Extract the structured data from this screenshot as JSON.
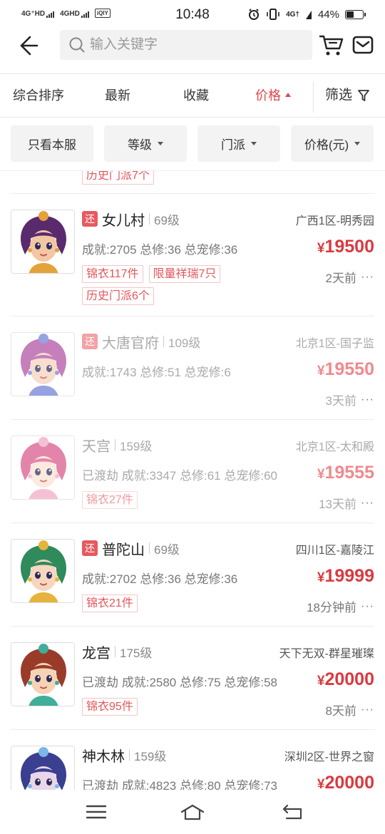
{
  "status_bar": {
    "net1": "4G⁺HD",
    "net2": "4GHD",
    "time": "10:48",
    "net3": "4G†",
    "battery": "44%"
  },
  "header": {
    "search_placeholder": "输入关键字"
  },
  "sort_tabs": [
    {
      "label": "综合排序",
      "active": false
    },
    {
      "label": "最新",
      "active": false
    },
    {
      "label": "收藏",
      "active": false
    },
    {
      "label": "价格",
      "active": true
    }
  ],
  "filter_label": "筛选",
  "chips": [
    {
      "label": "只看本服",
      "dropdown": false
    },
    {
      "label": "等级",
      "dropdown": true
    },
    {
      "label": "门派",
      "dropdown": true
    },
    {
      "label": "价格(元)",
      "dropdown": true
    }
  ],
  "partial_tag": "历史门派7个",
  "items": [
    {
      "badge": "还",
      "school": "女儿村",
      "level": "69级",
      "server": "广西1区-明秀园",
      "stats": "成就:2705 总修:36 总宠修:36",
      "price": "19500",
      "tags": [
        "锦衣117件",
        "限量祥瑞7只",
        "历史门派6个"
      ],
      "time": "2天前",
      "faded": false,
      "avatar": {
        "skin": "#f3c7a4",
        "hair": "#5a2a6e",
        "accent": "#e4a23a"
      }
    },
    {
      "badge": "还",
      "school": "大唐官府",
      "level": "109级",
      "server": "北京1区-国子监",
      "stats": "成就:1743 总修:51 总宠修:6",
      "price": "19550",
      "tags": [],
      "time": "3天前",
      "faded": true,
      "avatar": {
        "skin": "#f5d2bd",
        "hair": "#b04fa0",
        "accent": "#6f7fd6"
      }
    },
    {
      "badge": "",
      "school": "天宫",
      "level": "159级",
      "server": "北京1区-太和殿",
      "stats": "已渡劫 成就:3347 总修:61 总宠修:60",
      "price": "19555",
      "tags": [
        "锦衣27件"
      ],
      "time": "13天前",
      "faded": true,
      "avatar": {
        "skin": "#fbe1d4",
        "hair": "#d9578a",
        "accent": "#f2a9c4"
      }
    },
    {
      "badge": "还",
      "school": "普陀山",
      "level": "69级",
      "server": "四川1区-嘉陵江",
      "stats": "成就:2702 总修:36 总宠修:36",
      "price": "19999",
      "tags": [
        "锦衣21件"
      ],
      "time": "18分钟前",
      "faded": false,
      "avatar": {
        "skin": "#f7d6c0",
        "hair": "#2f8a5c",
        "accent": "#e6b43c"
      }
    },
    {
      "badge": "",
      "school": "龙宫",
      "level": "175级",
      "server": "天下无双-群星璀璨",
      "stats": "已渡劫 成就:2580 总修:75 总宠修:58",
      "price": "20000",
      "tags": [
        "锦衣95件"
      ],
      "time": "8天前",
      "faded": false,
      "avatar": {
        "skin": "#f6d3b6",
        "hair": "#9a3b2a",
        "accent": "#3fae9a"
      }
    },
    {
      "badge": "",
      "school": "神木林",
      "level": "159级",
      "server": "深圳2区-世界之窗",
      "stats": "已渡劫 成就:4823 总修:80 总宠修:73",
      "price": "20000",
      "tags": [],
      "time": "",
      "faded": false,
      "avatar": {
        "skin": "#e9d6ea",
        "hair": "#3b3f8f",
        "accent": "#7ab6e6"
      }
    }
  ],
  "currency": "¥",
  "more_glyph": "···",
  "colors": {
    "accent": "#e1464b",
    "price": "#d93a3f",
    "tag_border": "#f3c4c6",
    "chip_bg": "#f3f3f3"
  }
}
